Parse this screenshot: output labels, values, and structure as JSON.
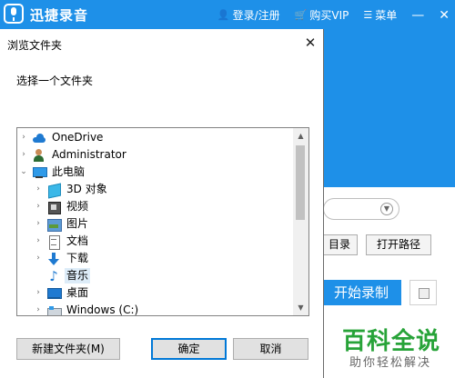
{
  "app": {
    "title": "迅捷录音",
    "nav": {
      "login": "登录/注册",
      "vip": "购买VIP",
      "menu": "菜单"
    },
    "dir_button": "目录",
    "open_path_button": "打开路径",
    "start_record_button": "开始录制"
  },
  "watermark": {
    "brand": "百科全说",
    "slogan": "助你轻松解决"
  },
  "dialog": {
    "title": "浏览文件夹",
    "close": "✕",
    "prompt": "选择一个文件夹",
    "tree": [
      {
        "label": "OneDrive",
        "icon": "onedrive-icon",
        "expander": "›"
      },
      {
        "label": "Administrator",
        "icon": "user-icon",
        "expander": "›"
      },
      {
        "label": "此电脑",
        "icon": "computer-icon",
        "expander": "⌄"
      },
      {
        "label": "3D 对象",
        "icon": "3d-objects-icon",
        "expander": "›"
      },
      {
        "label": "视频",
        "icon": "video-icon",
        "expander": "›"
      },
      {
        "label": "图片",
        "icon": "picture-icon",
        "expander": "›"
      },
      {
        "label": "文档",
        "icon": "document-icon",
        "expander": "›"
      },
      {
        "label": "下载",
        "icon": "download-icon",
        "expander": "›"
      },
      {
        "label": "音乐",
        "icon": "music-icon",
        "expander": "",
        "selected": true
      },
      {
        "label": "桌面",
        "icon": "desktop-icon",
        "expander": "›"
      },
      {
        "label": "Windows (C:)",
        "icon": "drive-icon",
        "expander": "›"
      }
    ],
    "buttons": {
      "new_folder": "新建文件夹(M)",
      "ok": "确定",
      "cancel": "取消"
    }
  }
}
